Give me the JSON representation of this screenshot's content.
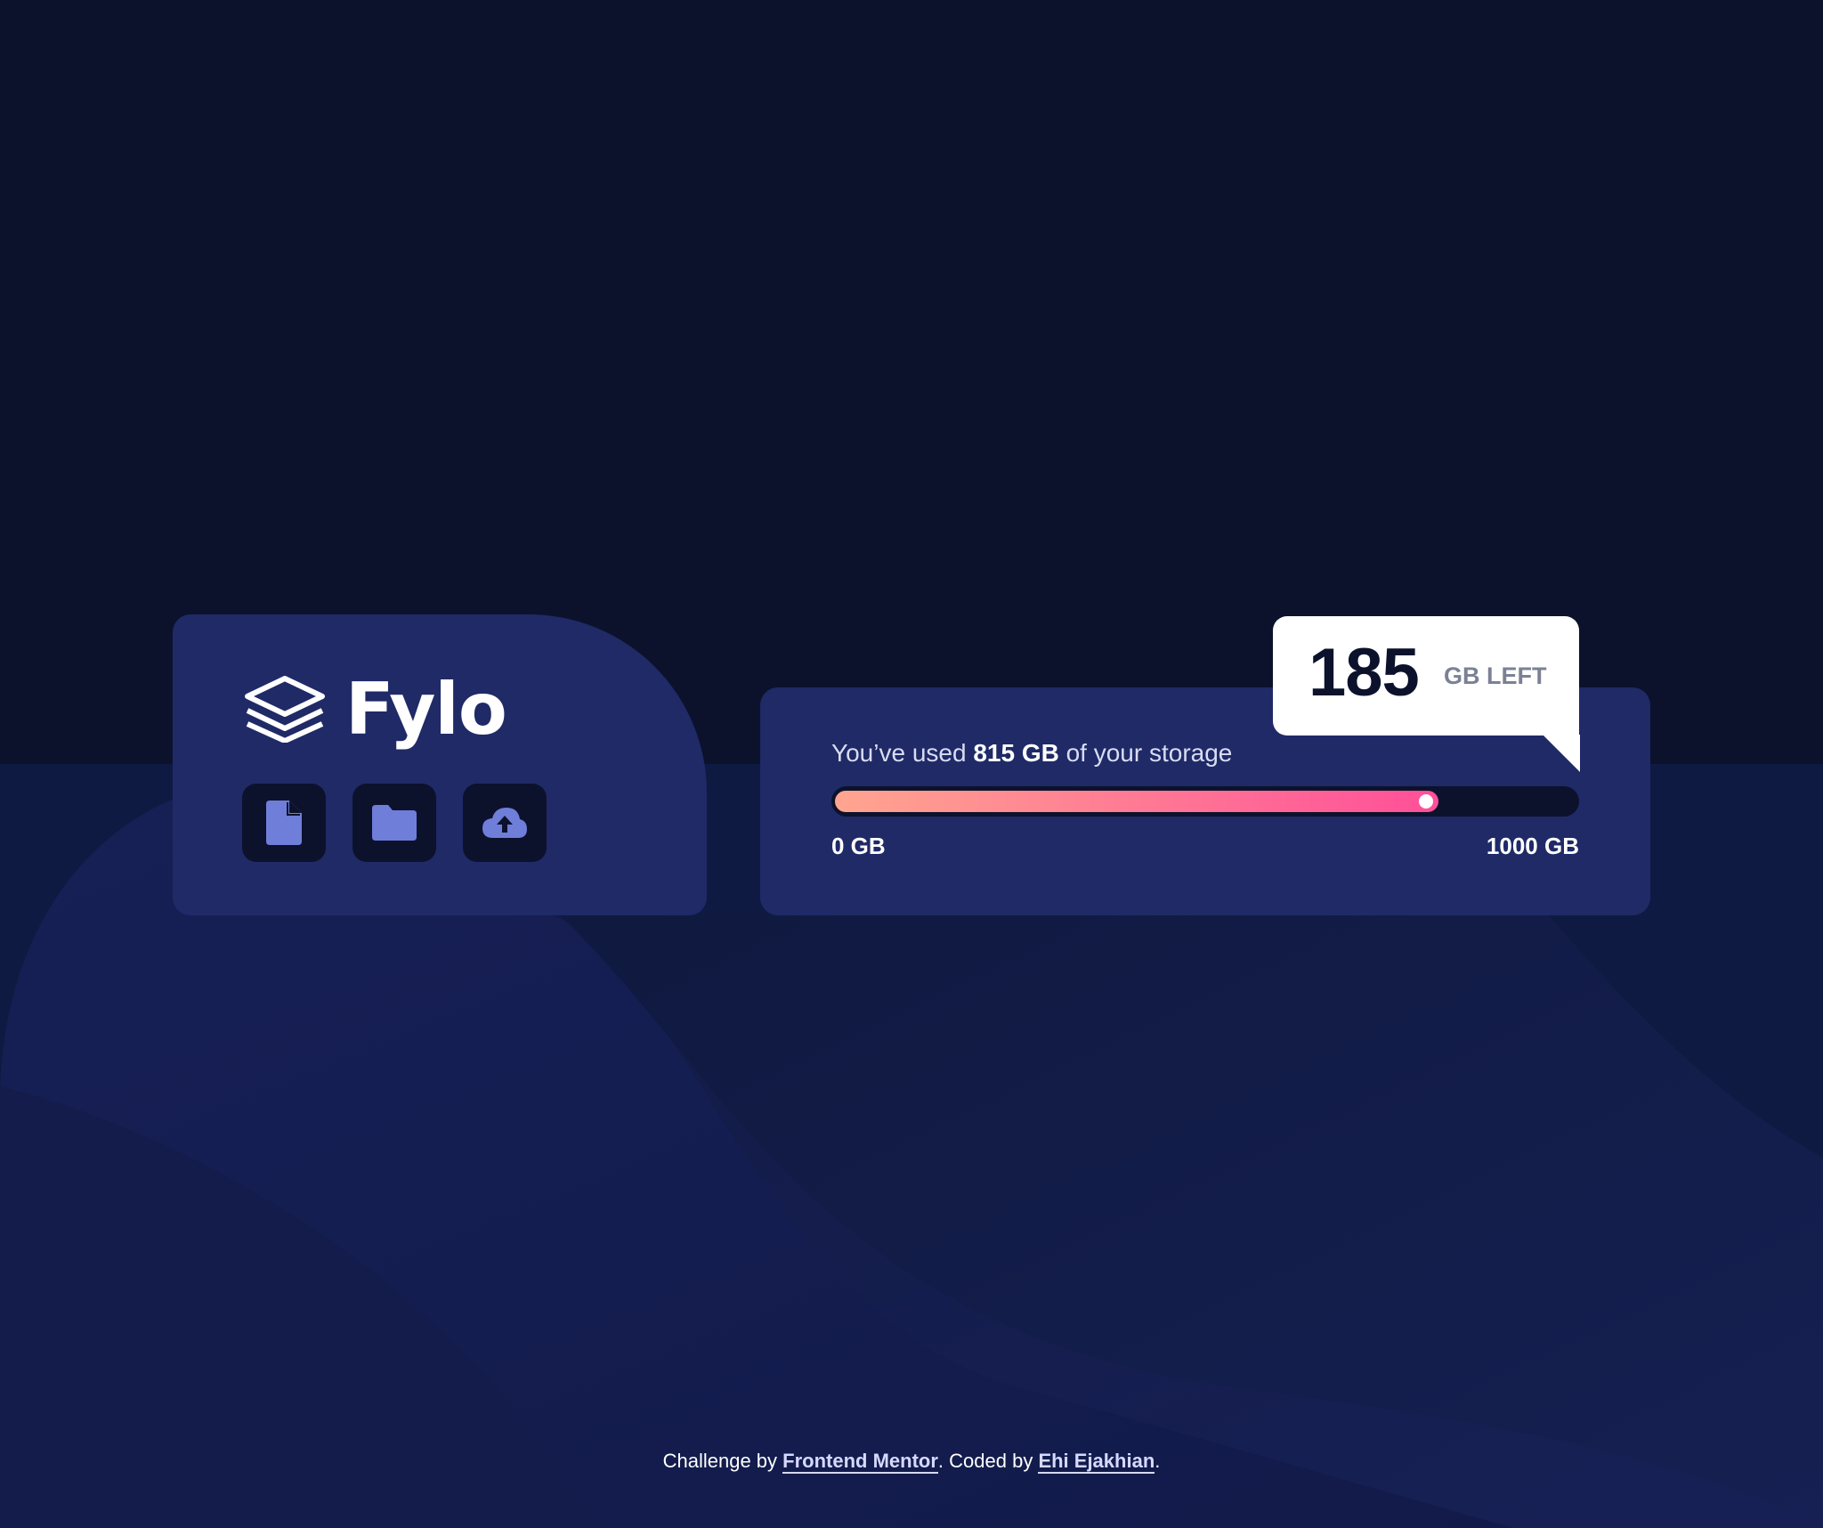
{
  "brand": {
    "name": "Fylo"
  },
  "tools": [
    {
      "name": "document",
      "icon": "document-icon"
    },
    {
      "name": "folder",
      "icon": "folder-icon"
    },
    {
      "name": "upload",
      "icon": "cloud-upload-icon"
    }
  ],
  "storage": {
    "prefix": "You’ve used ",
    "used": "815 GB",
    "suffix": " of your storage",
    "min_label": "0 GB",
    "max_label": "1000 GB",
    "used_fraction": 0.815
  },
  "callout": {
    "number": "185",
    "unit": "GB LEFT"
  },
  "footer": {
    "text1": "Challenge by ",
    "link1": "Frontend Mentor",
    "text2": ". Coded by ",
    "link2": "Ehi Ejakhian",
    "text3": "."
  },
  "colors": {
    "background": "#0c122c",
    "card": "#1f2a67",
    "gradient_start": "#ffa58f",
    "gradient_end": "#ff4f99",
    "icon": "#6f7ed9"
  }
}
